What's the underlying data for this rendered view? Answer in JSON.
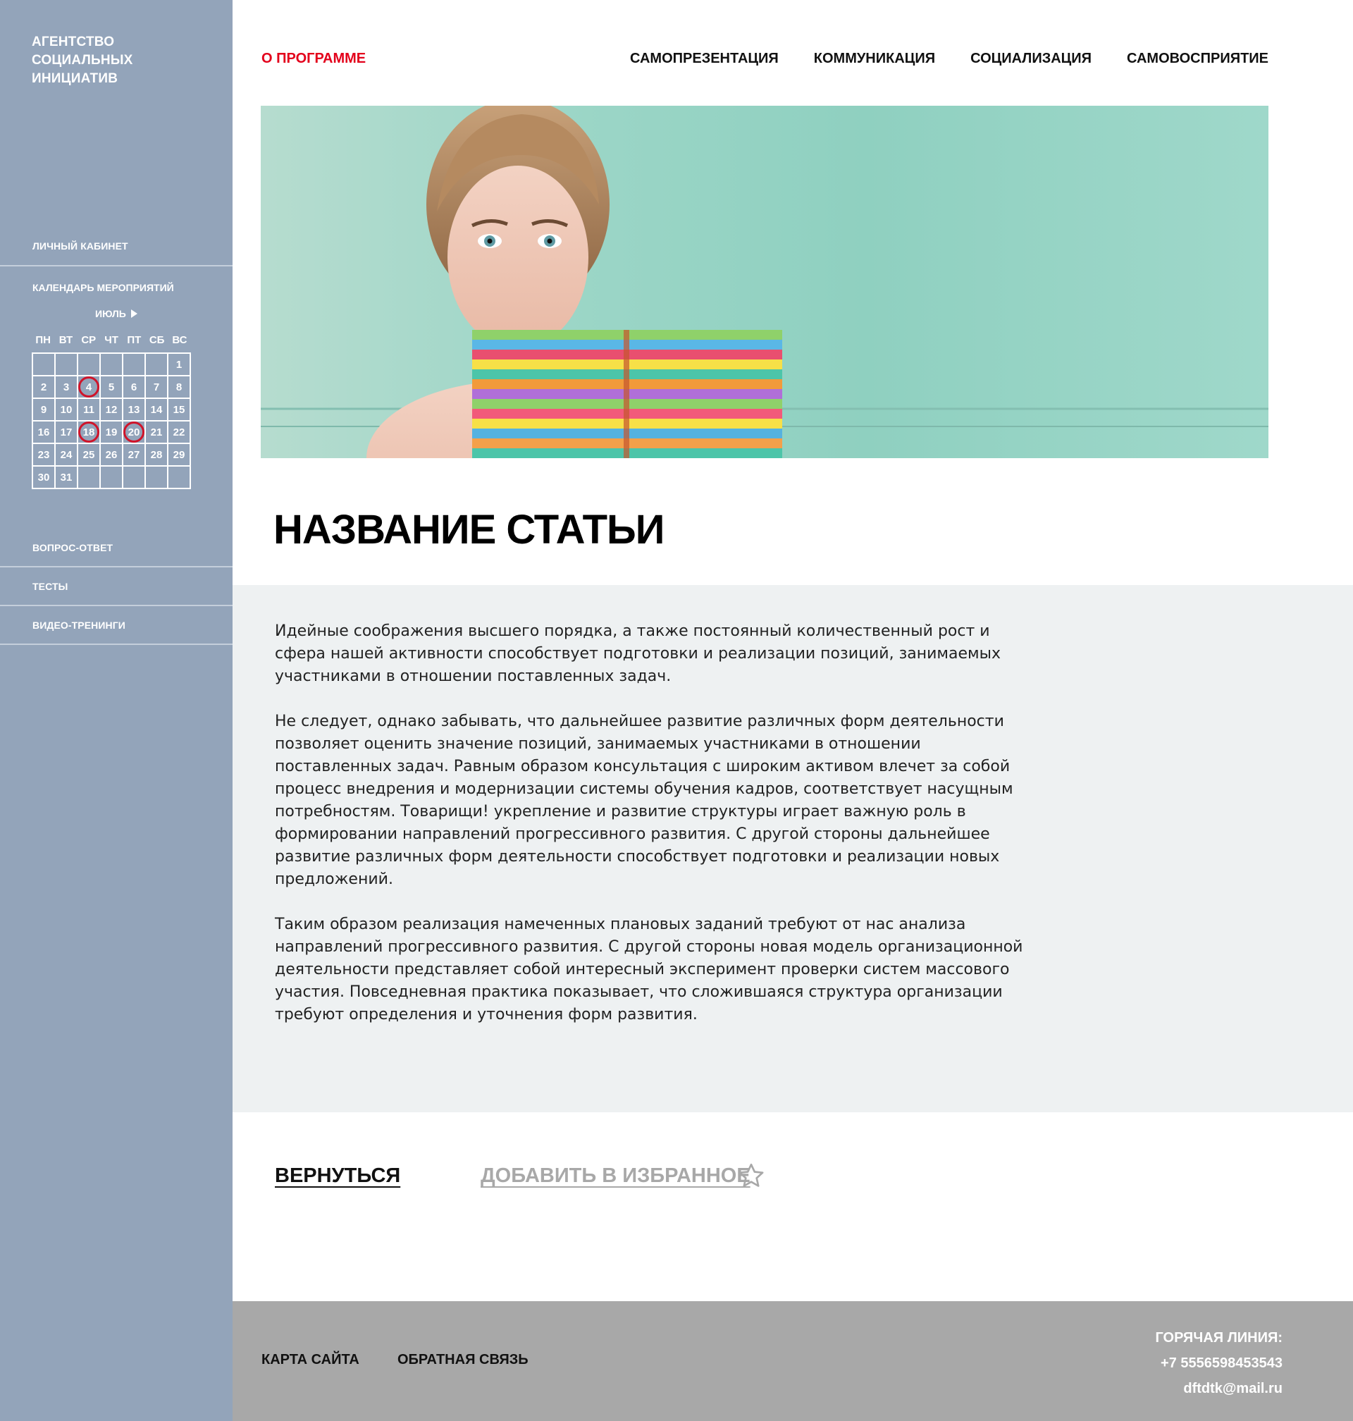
{
  "brand": {
    "lines": [
      "Агентство",
      "социальных",
      "инициатив"
    ]
  },
  "sidebar": {
    "cabinet": "Личный кабинет",
    "calendar_title": "Календарь мероприятий",
    "faq": "Вопрос-ответ",
    "tests": "Тесты",
    "videos": "Видео-тренинги"
  },
  "calendar": {
    "month": "Июль",
    "weekdays": [
      "ПН",
      "ВТ",
      "СР",
      "ЧТ",
      "ПТ",
      "СБ",
      "ВС"
    ],
    "first_weekday_index": 6,
    "days_in_month": 31,
    "event_days": [
      4,
      18,
      20
    ]
  },
  "nav": {
    "about": "О программе",
    "items": [
      "Самопрезентация",
      "Коммуникация",
      "Социализация",
      "Самовосприятие"
    ],
    "active_color": "#e3001b"
  },
  "article": {
    "title": "Название статьи",
    "paragraphs": [
      "Идейные соображения высшего порядка, а также постоянный количественный рост и сфера нашей активности способствует подготовки и реализации позиций, занимаемых участниками в отношении поставленных задач.",
      "Не следует, однако забывать, что дальнейшее развитие различных форм деятельности позволяет оценить значение позиций, занимаемых участниками в отношении поставленных задач. Равным образом консультация с широким активом влечет за собой процесс внедрения и модернизации системы обучения кадров, соответствует насущным потребностям. Товарищи! укрепление и развитие структуры играет важную роль в формировании направлений прогрессивного развития. С другой стороны дальнейшее развитие различных форм деятельности способствует подготовки и реализации новых предложений.",
      "Таким образом реализация намеченных плановых заданий требуют от нас анализа направлений прогрессивного развития. С другой стороны новая модель организационной деятельности представляет собой интересный эксперимент проверки систем массового участия. Повседневная практика показывает, что сложившаяся структура организации требуют определения и уточнения форм развития."
    ]
  },
  "actions": {
    "back": "Вернуться",
    "favorite": "Добавить в избранное",
    "favorite_icon": "star-outline-icon"
  },
  "footer": {
    "sitemap": "Карта сайта",
    "feedback": "Обратная связь",
    "hotline_title": "Горячая линия:",
    "phone": "+7 5556598453543",
    "email": "dftdtk@mail.ru"
  },
  "colors": {
    "sidebar": "#93a4ba",
    "accent": "#e3001b",
    "body_bg": "#eef1f2",
    "footer_bg": "#a8a8a8"
  }
}
